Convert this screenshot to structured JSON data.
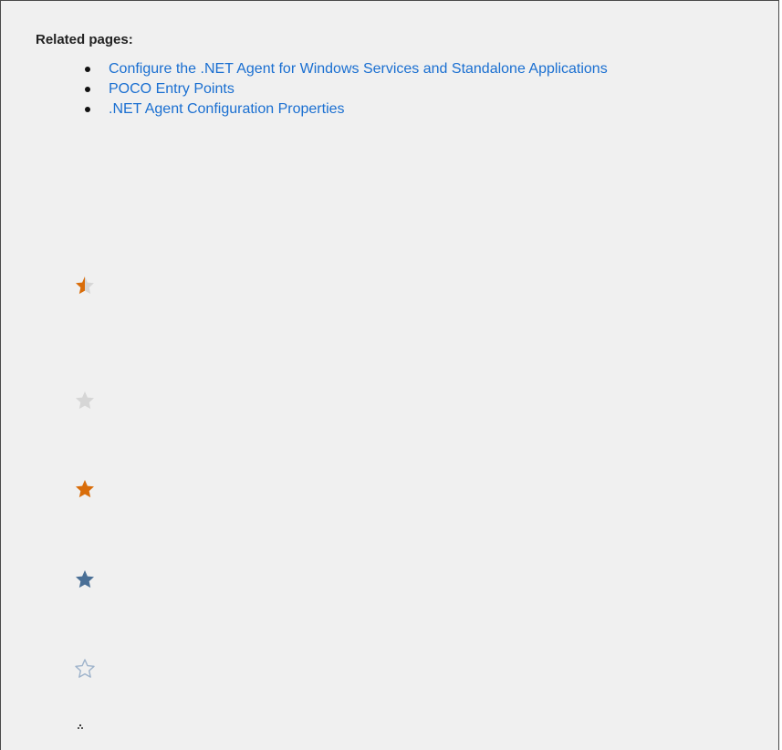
{
  "related": {
    "heading": "Related pages:",
    "links": [
      "Configure the .NET Agent for Windows Services and Standalone Applications",
      "POCO Entry Points",
      ".NET Agent Configuration Properties"
    ]
  },
  "colors": {
    "link": "#1a6fd1",
    "star_orange": "#d96d0a",
    "star_gray": "#d6d6d6",
    "star_blue": "#4a6f96",
    "star_outline": "#9eb3cb"
  },
  "icons": [
    "half-star-icon",
    "gray-star-icon",
    "orange-star-icon",
    "blue-star-icon",
    "outline-star-icon",
    "tiny-loader-icon"
  ]
}
